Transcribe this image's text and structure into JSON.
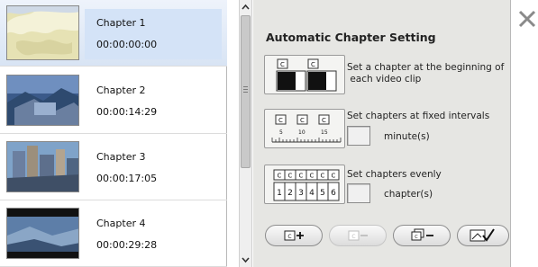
{
  "chapters": [
    {
      "title": "Chapter 1",
      "time": "00:00:00:00",
      "selected": true
    },
    {
      "title": "Chapter 2",
      "time": "00:00:14:29",
      "selected": false
    },
    {
      "title": "Chapter 3",
      "time": "00:00:17:05",
      "selected": false
    },
    {
      "title": "Chapter 4",
      "time": "00:00:29:28",
      "selected": false
    }
  ],
  "panel": {
    "title": "Automatic Chapter Setting",
    "option_beginning": {
      "text_line1": "Set a chapter at the beginning of",
      "text_line2": " each video clip",
      "icon": "chapter-per-clip-icon"
    },
    "option_intervals": {
      "text": "Set chapters at fixed intervals",
      "unit": "minute(s)",
      "value": "",
      "ruler_marks": [
        "5",
        "10",
        "15"
      ],
      "icon": "fixed-interval-icon"
    },
    "option_evenly": {
      "text": "Set chapters evenly",
      "unit": "chapter(s)",
      "value": "",
      "numbers": [
        "1",
        "2",
        "3",
        "4",
        "5",
        "6"
      ],
      "icon": "even-chapters-icon"
    }
  },
  "toolbar": {
    "buttons": [
      {
        "name": "add-chapter",
        "icon": "add-chapter-icon",
        "enabled": true
      },
      {
        "name": "remove-chapter",
        "icon": "remove-chapter-icon",
        "enabled": false
      },
      {
        "name": "remove-all-chapters",
        "icon": "remove-all-chapters-icon",
        "enabled": true
      },
      {
        "name": "apply",
        "icon": "apply-check-icon",
        "enabled": true
      }
    ]
  },
  "window": {
    "close_icon": "close-icon"
  },
  "chapter_mark_letter": "C",
  "colors": {
    "selected_row": "#d4e3f7",
    "panel_bg": "#e6e6e3",
    "scroll_thumb": "#c9c9c9"
  }
}
